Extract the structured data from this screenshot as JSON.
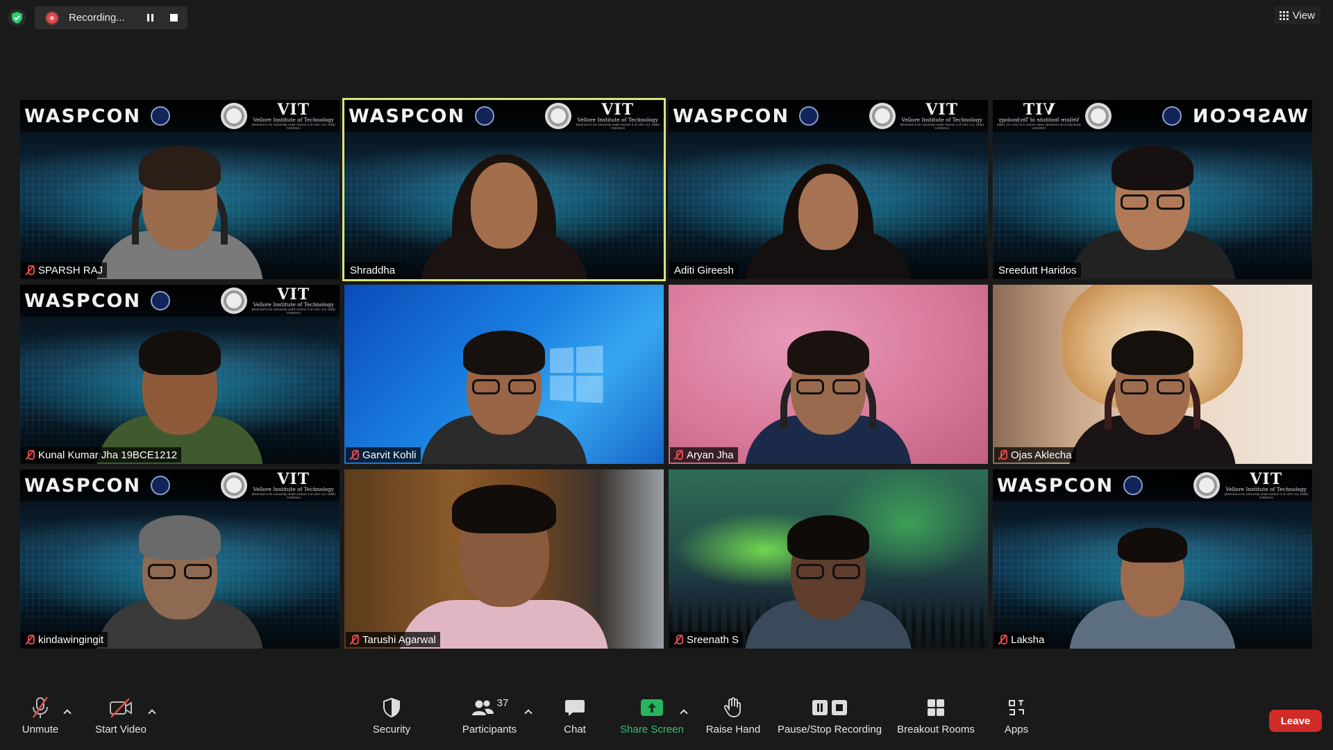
{
  "top_bar": {
    "recording_label": "Recording...",
    "view_label": "View"
  },
  "waspcon_banner": {
    "title": "WASPCON",
    "vit_title": "VIT",
    "vit_subtitle": "Vellore Institute of Technology",
    "vit_fine_print": "(Deemed to be University under section 3 of UGC Act, 1956)",
    "vit_location": "CHENNAI"
  },
  "participants": [
    {
      "name": "SPARSH RAJ",
      "muted": true,
      "background": "waspcon",
      "active": false
    },
    {
      "name": "Shraddha",
      "muted": false,
      "background": "waspcon",
      "active": true
    },
    {
      "name": "Aditi Gireesh",
      "muted": false,
      "background": "waspcon",
      "active": false
    },
    {
      "name": "Sreedutt Haridos",
      "muted": false,
      "background": "waspcon-mirrored",
      "active": false
    },
    {
      "name": "Kunal Kumar Jha 19BCE1212",
      "muted": true,
      "background": "waspcon",
      "active": false
    },
    {
      "name": "Garvit Kohli",
      "muted": true,
      "background": "windows-blue",
      "active": false
    },
    {
      "name": "Aryan Jha",
      "muted": true,
      "background": "pink-wall",
      "active": false
    },
    {
      "name": "Ojas Aklecha",
      "muted": true,
      "background": "dog-room",
      "active": false
    },
    {
      "name": "kindawingingit",
      "muted": true,
      "background": "waspcon",
      "active": false
    },
    {
      "name": "Tarushi Agarwal",
      "muted": true,
      "background": "brown-room",
      "active": false
    },
    {
      "name": "Sreenath S",
      "muted": true,
      "background": "aurora",
      "active": false
    },
    {
      "name": "Laksha",
      "muted": true,
      "background": "waspcon",
      "active": false
    }
  ],
  "toolbar": {
    "unmute": "Unmute",
    "start_video": "Start Video",
    "security": "Security",
    "participants": "Participants",
    "participants_count": "37",
    "chat": "Chat",
    "share_screen": "Share Screen",
    "raise_hand": "Raise Hand",
    "pause_stop_recording": "Pause/Stop Recording",
    "breakout_rooms": "Breakout Rooms",
    "apps": "Apps",
    "leave": "Leave"
  },
  "colors": {
    "active_speaker_border": "#d7e57b",
    "share_green": "#2ab35f",
    "leave_red": "#d12b27",
    "muted_red": "#e14b4b",
    "shield_green": "#2ecc71"
  }
}
